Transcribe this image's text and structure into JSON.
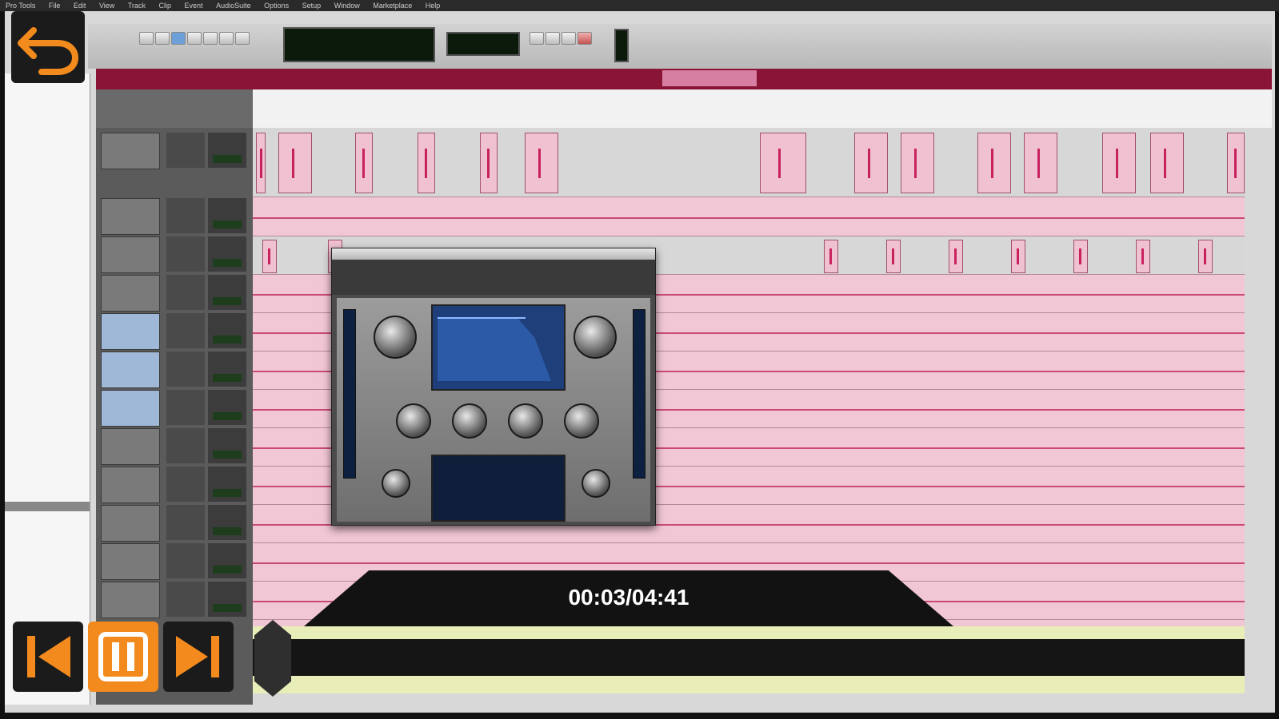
{
  "menubar": {
    "items": [
      "Pro Tools",
      "File",
      "Edit",
      "View",
      "Track",
      "Clip",
      "Event",
      "AudioSuite",
      "Options",
      "Setup",
      "Window",
      "Marketplace",
      "Help"
    ]
  },
  "player": {
    "time_display": "00:03/04:41",
    "accent_color": "#f28a1e",
    "icons": {
      "back": "back-arrow-icon",
      "prev": "skip-previous-icon",
      "pause": "pause-icon",
      "next": "skip-next-icon"
    }
  }
}
